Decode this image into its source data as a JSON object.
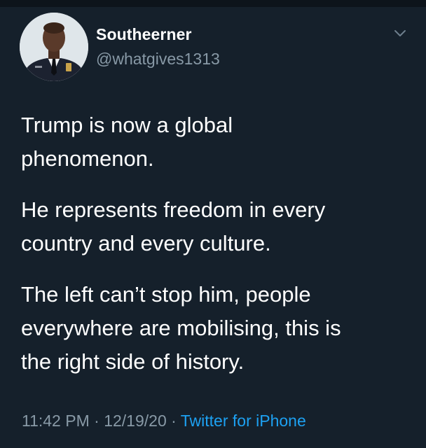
{
  "tweet": {
    "author": {
      "display_name": "Southeerner",
      "handle": "@whatgives1313",
      "avatar_icon": "user-avatar"
    },
    "menu_icon": "chevron-down-icon",
    "paragraphs": [
      [
        "Trump is now a global",
        "phenomenon."
      ],
      [
        "He represents freedom in every",
        "country and every culture."
      ],
      [
        "The left can’t stop him, people",
        "everywhere are mobilising, this is",
        "the right side of history."
      ]
    ],
    "meta": {
      "time": "11:42 PM",
      "separator": "·",
      "date": "12/19/20",
      "source": "Twitter for iPhone"
    }
  },
  "colors": {
    "background": "#15202b",
    "text": "#ffffff",
    "secondary_text": "#8899a6",
    "link": "#1da1f2"
  }
}
